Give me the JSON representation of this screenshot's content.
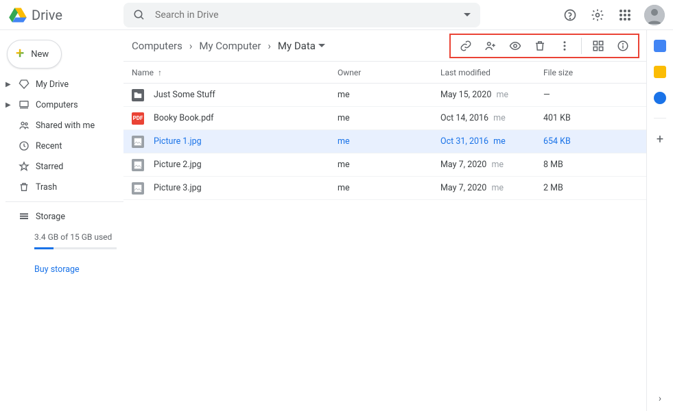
{
  "app_name": "Drive",
  "search_placeholder": "Search in Drive",
  "new_button_label": "New",
  "nav": {
    "my_drive": "My Drive",
    "computers": "Computers",
    "shared": "Shared with me",
    "recent": "Recent",
    "starred": "Starred",
    "trash": "Trash",
    "storage": "Storage"
  },
  "storage_text": "3.4 GB of 15 GB used",
  "buy_storage": "Buy storage",
  "breadcrumbs": [
    "Computers",
    "My Computer",
    "My Data"
  ],
  "columns": {
    "name": "Name",
    "owner": "Owner",
    "modified": "Last modified",
    "size": "File size"
  },
  "files": [
    {
      "name": "Just Some Stuff",
      "owner": "me",
      "modified": "May 15, 2020",
      "me": "me",
      "size": "—",
      "type": "folder",
      "selected": false
    },
    {
      "name": "Booky Book.pdf",
      "owner": "me",
      "modified": "Oct 14, 2016",
      "me": "me",
      "size": "401 KB",
      "type": "pdf",
      "selected": false
    },
    {
      "name": "Picture 1.jpg",
      "owner": "me",
      "modified": "Oct 31, 2016",
      "me": "me",
      "size": "654 KB",
      "type": "img",
      "selected": true
    },
    {
      "name": "Picture 2.jpg",
      "owner": "me",
      "modified": "May 7, 2020",
      "me": "me",
      "size": "8 MB",
      "type": "img",
      "selected": false
    },
    {
      "name": "Picture 3.jpg",
      "owner": "me",
      "modified": "May 7, 2020",
      "me": "me",
      "size": "2 MB",
      "type": "img",
      "selected": false
    }
  ]
}
